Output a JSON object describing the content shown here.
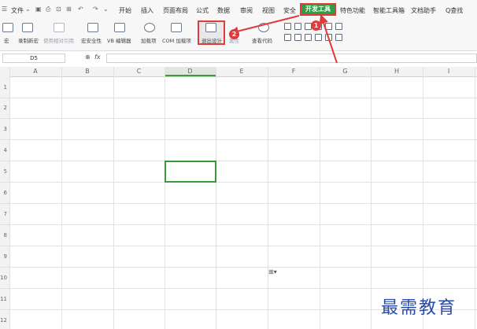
{
  "menu": {
    "file": "文件",
    "tabs": [
      "开始",
      "插入",
      "页面布局",
      "公式",
      "数据",
      "审阅",
      "视图",
      "安全",
      "开发工具",
      "特色功能",
      "智能工具箱",
      "文档助手"
    ],
    "search": "Q查找"
  },
  "ribbon": {
    "macro": "宏",
    "record_macro": "录制新宏",
    "relative_ref": "使用相对引用",
    "macro_security": "宏安全性",
    "vb_editor": "VB 编辑器",
    "addins": "加载项",
    "com_addins": "COM 加载项",
    "design_mode": "退出设计",
    "properties": "属性",
    "view_code": "查看代码"
  },
  "formula_bar": {
    "name_box": "D5",
    "fx": "fx",
    "value": ""
  },
  "columns": [
    "A",
    "B",
    "C",
    "D",
    "E",
    "F",
    "G",
    "H",
    "I"
  ],
  "rows": [
    "1",
    "2",
    "3",
    "4",
    "5",
    "6",
    "7",
    "8",
    "9",
    "10",
    "11",
    "12"
  ],
  "selected_cell": "D5",
  "annotations": {
    "badge1": "1",
    "badge2": "2"
  },
  "watermark": "最需教育",
  "colors": {
    "accent_green": "#2e9f45",
    "annotation_red": "#e03a3a",
    "watermark_blue": "#2a4aa8"
  }
}
